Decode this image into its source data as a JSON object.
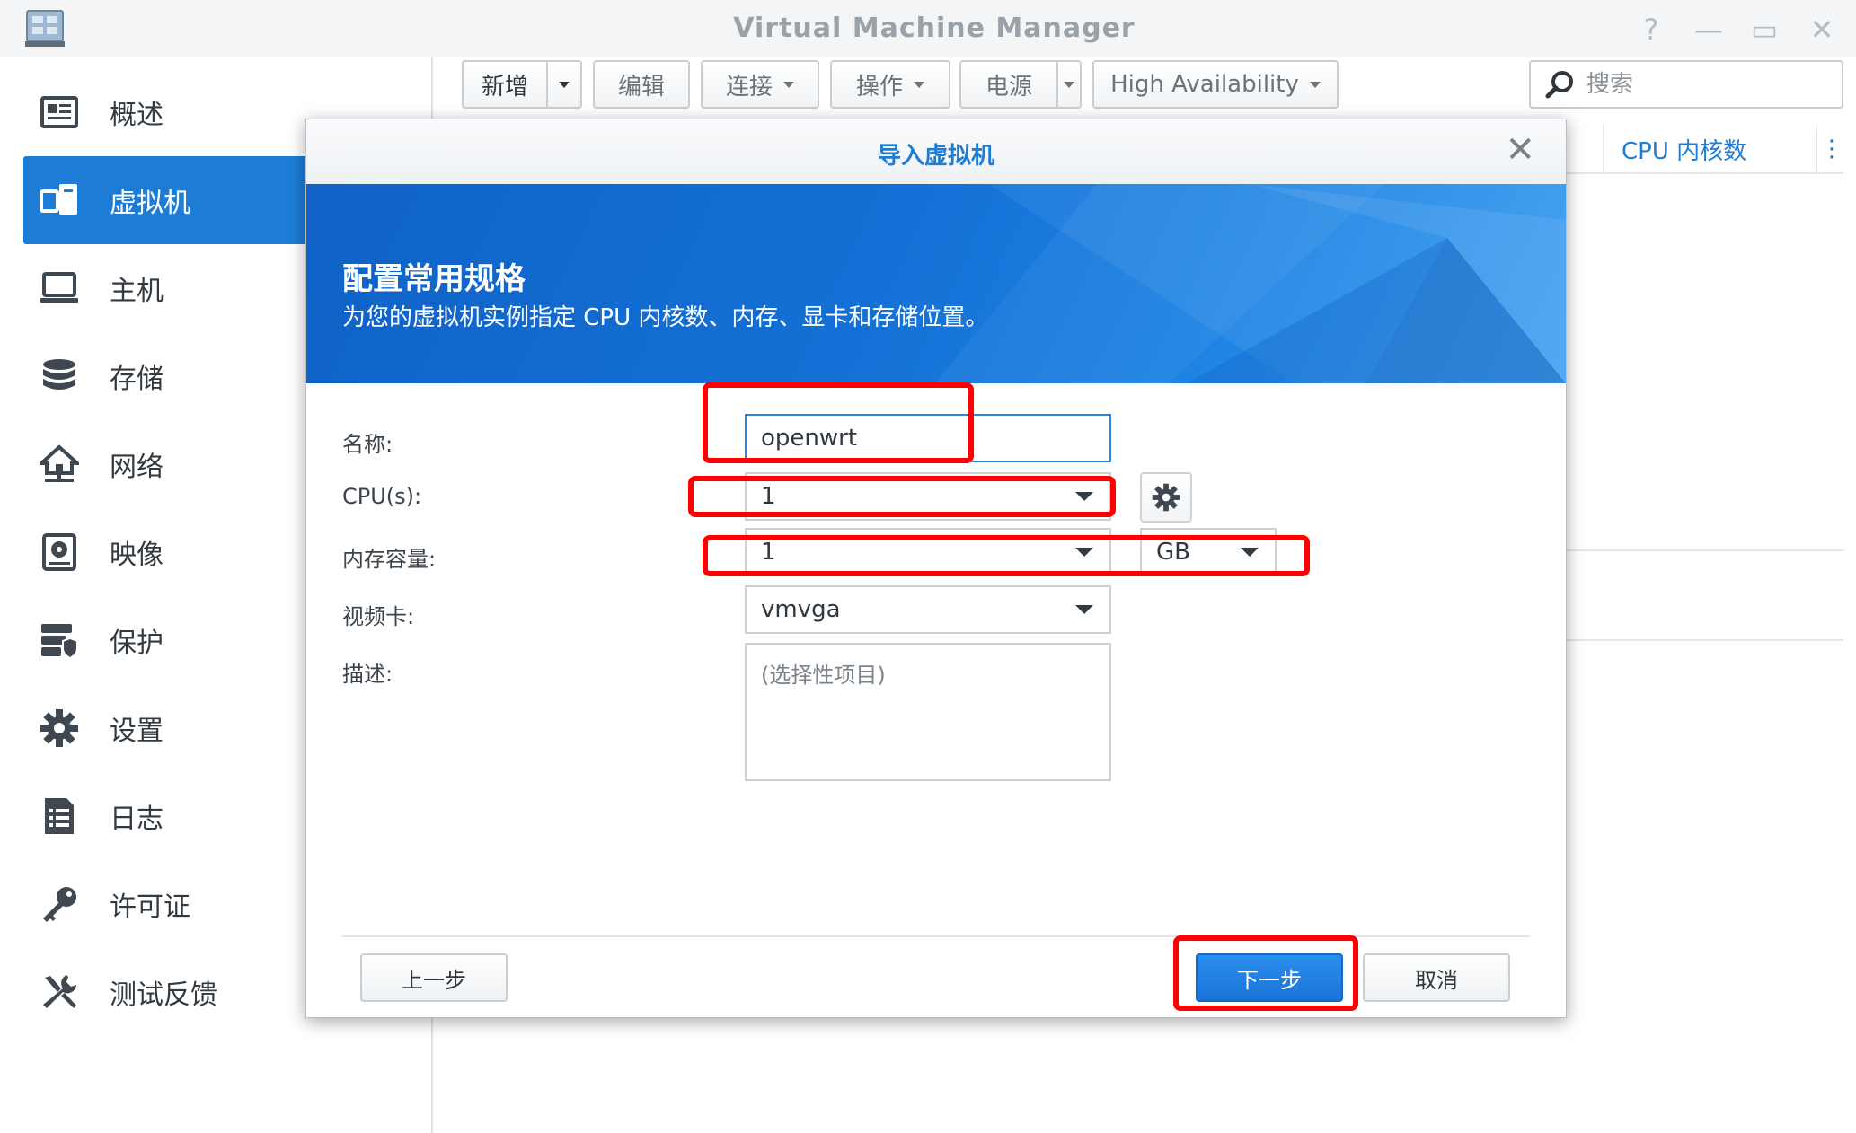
{
  "window": {
    "title": "Virtual Machine Manager",
    "controls": {
      "help": "?",
      "minimize": "—",
      "maximize": "▭",
      "close": "✕"
    }
  },
  "sidebar": {
    "items": [
      {
        "label": "概述",
        "icon": "overview-icon"
      },
      {
        "label": "虚拟机",
        "icon": "virtual-machine-icon",
        "active": true
      },
      {
        "label": "主机",
        "icon": "host-icon"
      },
      {
        "label": "存储",
        "icon": "storage-icon"
      },
      {
        "label": "网络",
        "icon": "network-icon"
      },
      {
        "label": "映像",
        "icon": "image-icon"
      },
      {
        "label": "保护",
        "icon": "protection-icon"
      },
      {
        "label": "设置",
        "icon": "settings-icon"
      },
      {
        "label": "日志",
        "icon": "log-icon"
      },
      {
        "label": "许可证",
        "icon": "license-icon"
      },
      {
        "label": "测试反馈",
        "icon": "feedback-icon"
      }
    ]
  },
  "toolbar": {
    "add": "新增",
    "edit": "编辑",
    "connect": "连接",
    "action": "操作",
    "power": "电源",
    "high_availability": "High Availability",
    "search_placeholder": "搜索"
  },
  "list": {
    "column_cpu": "CPU 内核数"
  },
  "dialog": {
    "title": "导入虚拟机",
    "banner_title": "配置常用规格",
    "banner_subtitle": "为您的虚拟机实例指定 CPU 内核数、内存、显卡和存储位置。",
    "fields": {
      "name_label": "名称:",
      "name_value": "openwrt",
      "cpu_label": "CPU(s):",
      "cpu_value": "1",
      "memory_label": "内存容量:",
      "memory_value": "1",
      "memory_unit": "GB",
      "video_label": "视频卡:",
      "video_value": "vmvga",
      "desc_label": "描述:",
      "desc_placeholder": "(选择性项目)"
    },
    "buttons": {
      "back": "上一步",
      "next": "下一步",
      "cancel": "取消"
    }
  },
  "colors": {
    "accent": "#1d7dd6",
    "highlight": "#ff0000"
  }
}
